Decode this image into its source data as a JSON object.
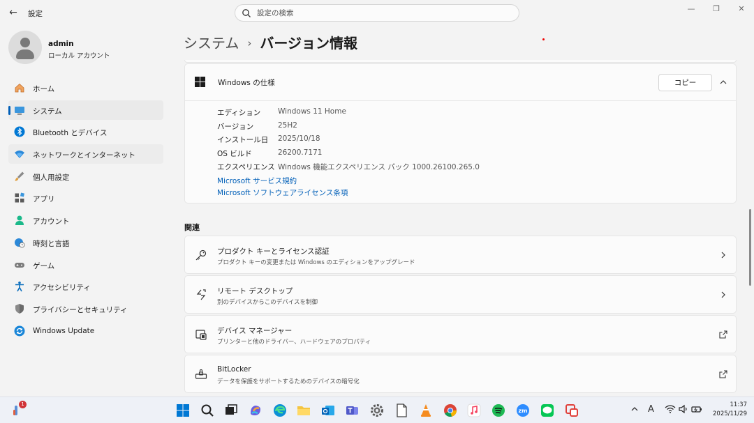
{
  "window": {
    "title": "設定",
    "search_placeholder": "設定の検索",
    "minimize": "—",
    "maximize": "❐",
    "close": "✕"
  },
  "profile": {
    "name": "admin",
    "account_type": "ローカル アカウント"
  },
  "nav": [
    {
      "label": "ホーム",
      "icon": "home-icon",
      "state": "normal"
    },
    {
      "label": "システム",
      "icon": "system-icon",
      "state": "active"
    },
    {
      "label": "Bluetooth とデバイス",
      "icon": "bluetooth-icon",
      "state": "normal"
    },
    {
      "label": "ネットワークとインターネット",
      "icon": "network-icon",
      "state": "hover"
    },
    {
      "label": "個人用設定",
      "icon": "brush-icon",
      "state": "normal"
    },
    {
      "label": "アプリ",
      "icon": "apps-icon",
      "state": "normal"
    },
    {
      "label": "アカウント",
      "icon": "account-icon",
      "state": "normal"
    },
    {
      "label": "時刻と言語",
      "icon": "globe-clock-icon",
      "state": "normal"
    },
    {
      "label": "ゲーム",
      "icon": "gamepad-icon",
      "state": "normal"
    },
    {
      "label": "アクセシビリティ",
      "icon": "accessibility-icon",
      "state": "normal"
    },
    {
      "label": "プライバシーとセキュリティ",
      "icon": "shield-icon",
      "state": "normal"
    },
    {
      "label": "Windows Update",
      "icon": "update-icon",
      "state": "normal"
    }
  ],
  "breadcrumb": {
    "parent": "システム",
    "separator": "›",
    "current": "バージョン情報"
  },
  "windows_spec": {
    "title": "Windows の仕様",
    "copy_label": "コピー",
    "rows": [
      {
        "key": "エディション",
        "value": "Windows 11 Home"
      },
      {
        "key": "バージョン",
        "value": "25H2"
      },
      {
        "key": "インストール日",
        "value": "2025/10/18"
      },
      {
        "key": "OS ビルド",
        "value": "26200.7171"
      },
      {
        "key": "エクスペリエンス",
        "value": "Windows 機能エクスペリエンス パック 1000.26100.265.0"
      }
    ],
    "links": [
      "Microsoft サービス規約",
      "Microsoft ソフトウェアライセンス条項"
    ]
  },
  "related": {
    "heading": "関連",
    "items": [
      {
        "title": "プロダクト キーとライセンス認証",
        "subtitle": "プロダクト キーの変更または Windows のエディションをアップグレード",
        "icon": "key-icon",
        "action": "chevron-right-icon"
      },
      {
        "title": "リモート デスクトップ",
        "subtitle": "別のデバイスからこのデバイスを制御",
        "icon": "remote-desktop-icon",
        "action": "chevron-right-icon"
      },
      {
        "title": "デバイス マネージャー",
        "subtitle": "プリンターと他のドライバー、ハードウェアのプロパティ",
        "icon": "device-manager-icon",
        "action": "external-link-icon"
      },
      {
        "title": "BitLocker",
        "subtitle": "データを保護をサポートするためのデバイスの暗号化",
        "icon": "bitlocker-icon",
        "action": "external-link-icon"
      }
    ]
  },
  "taskbar": {
    "notification_count": "1",
    "clock_time": "11:37",
    "clock_date": "2025/11/29",
    "ime_label": "A",
    "colors": {
      "accent": "#005fb8",
      "windows_blue": "#0078d4",
      "badge_red": "#d13438"
    }
  }
}
